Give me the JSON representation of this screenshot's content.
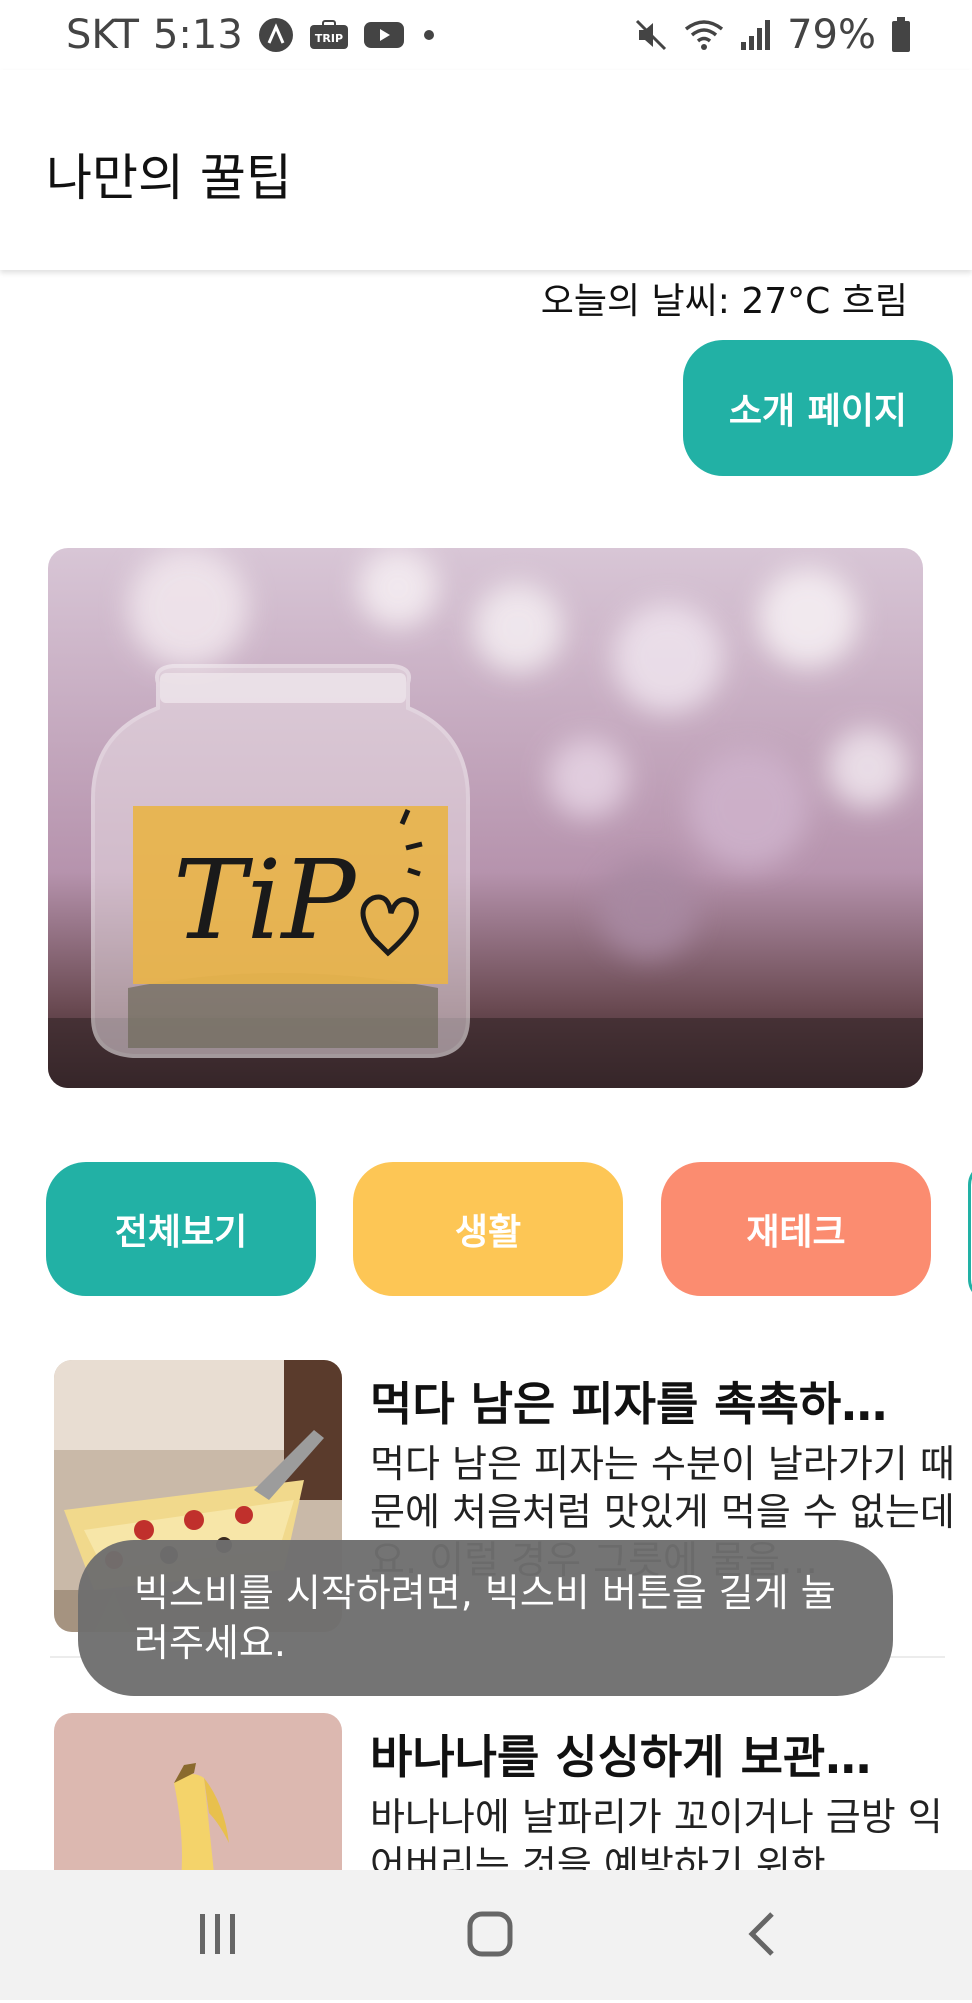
{
  "status_bar": {
    "carrier": "SKT",
    "time": "5:13",
    "battery": "79%",
    "icons": [
      "app-a-icon",
      "trip-icon",
      "youtube-icon",
      "dot-icon",
      "mute-icon",
      "wifi-icon",
      "signal-icon",
      "battery-icon"
    ],
    "trip_label": "TRIP"
  },
  "app_bar": {
    "title": "나만의 꿀팁"
  },
  "weather": {
    "text": "오늘의 날씨: 27°C 흐림"
  },
  "about_button": {
    "label": "소개 페이지"
  },
  "hero": {
    "label_text": "TiP"
  },
  "categories": [
    {
      "label": "전체보기",
      "color": "#22b1a5"
    },
    {
      "label": "생활",
      "color": "#fdc655"
    },
    {
      "label": "재테크",
      "color": "#fb8c70"
    }
  ],
  "tips": [
    {
      "title": "먹다 남은 피자를 촉촉하…",
      "body": "먹다 남은 피자는 수분이 날라가기 때문에 처음처럼 맛있게 먹을 수 없는데요. 이럴 경우 그릇에 물을…"
    },
    {
      "title": "바나나를 싱싱하게 보관…",
      "body": "바나나에 날파리가 꼬이거나 금방 익어버리는 것을 예방하기 위한"
    }
  ],
  "toast": {
    "text": "빅스비를 시작하려면, 빅스비 버튼을 길게 눌러주세요."
  },
  "nav_bar": {
    "icons": [
      "recent-apps-icon",
      "home-icon",
      "back-icon"
    ]
  },
  "colors": {
    "accent": "#22b1a5",
    "yellow": "#fdc655",
    "coral": "#fb8c70"
  }
}
